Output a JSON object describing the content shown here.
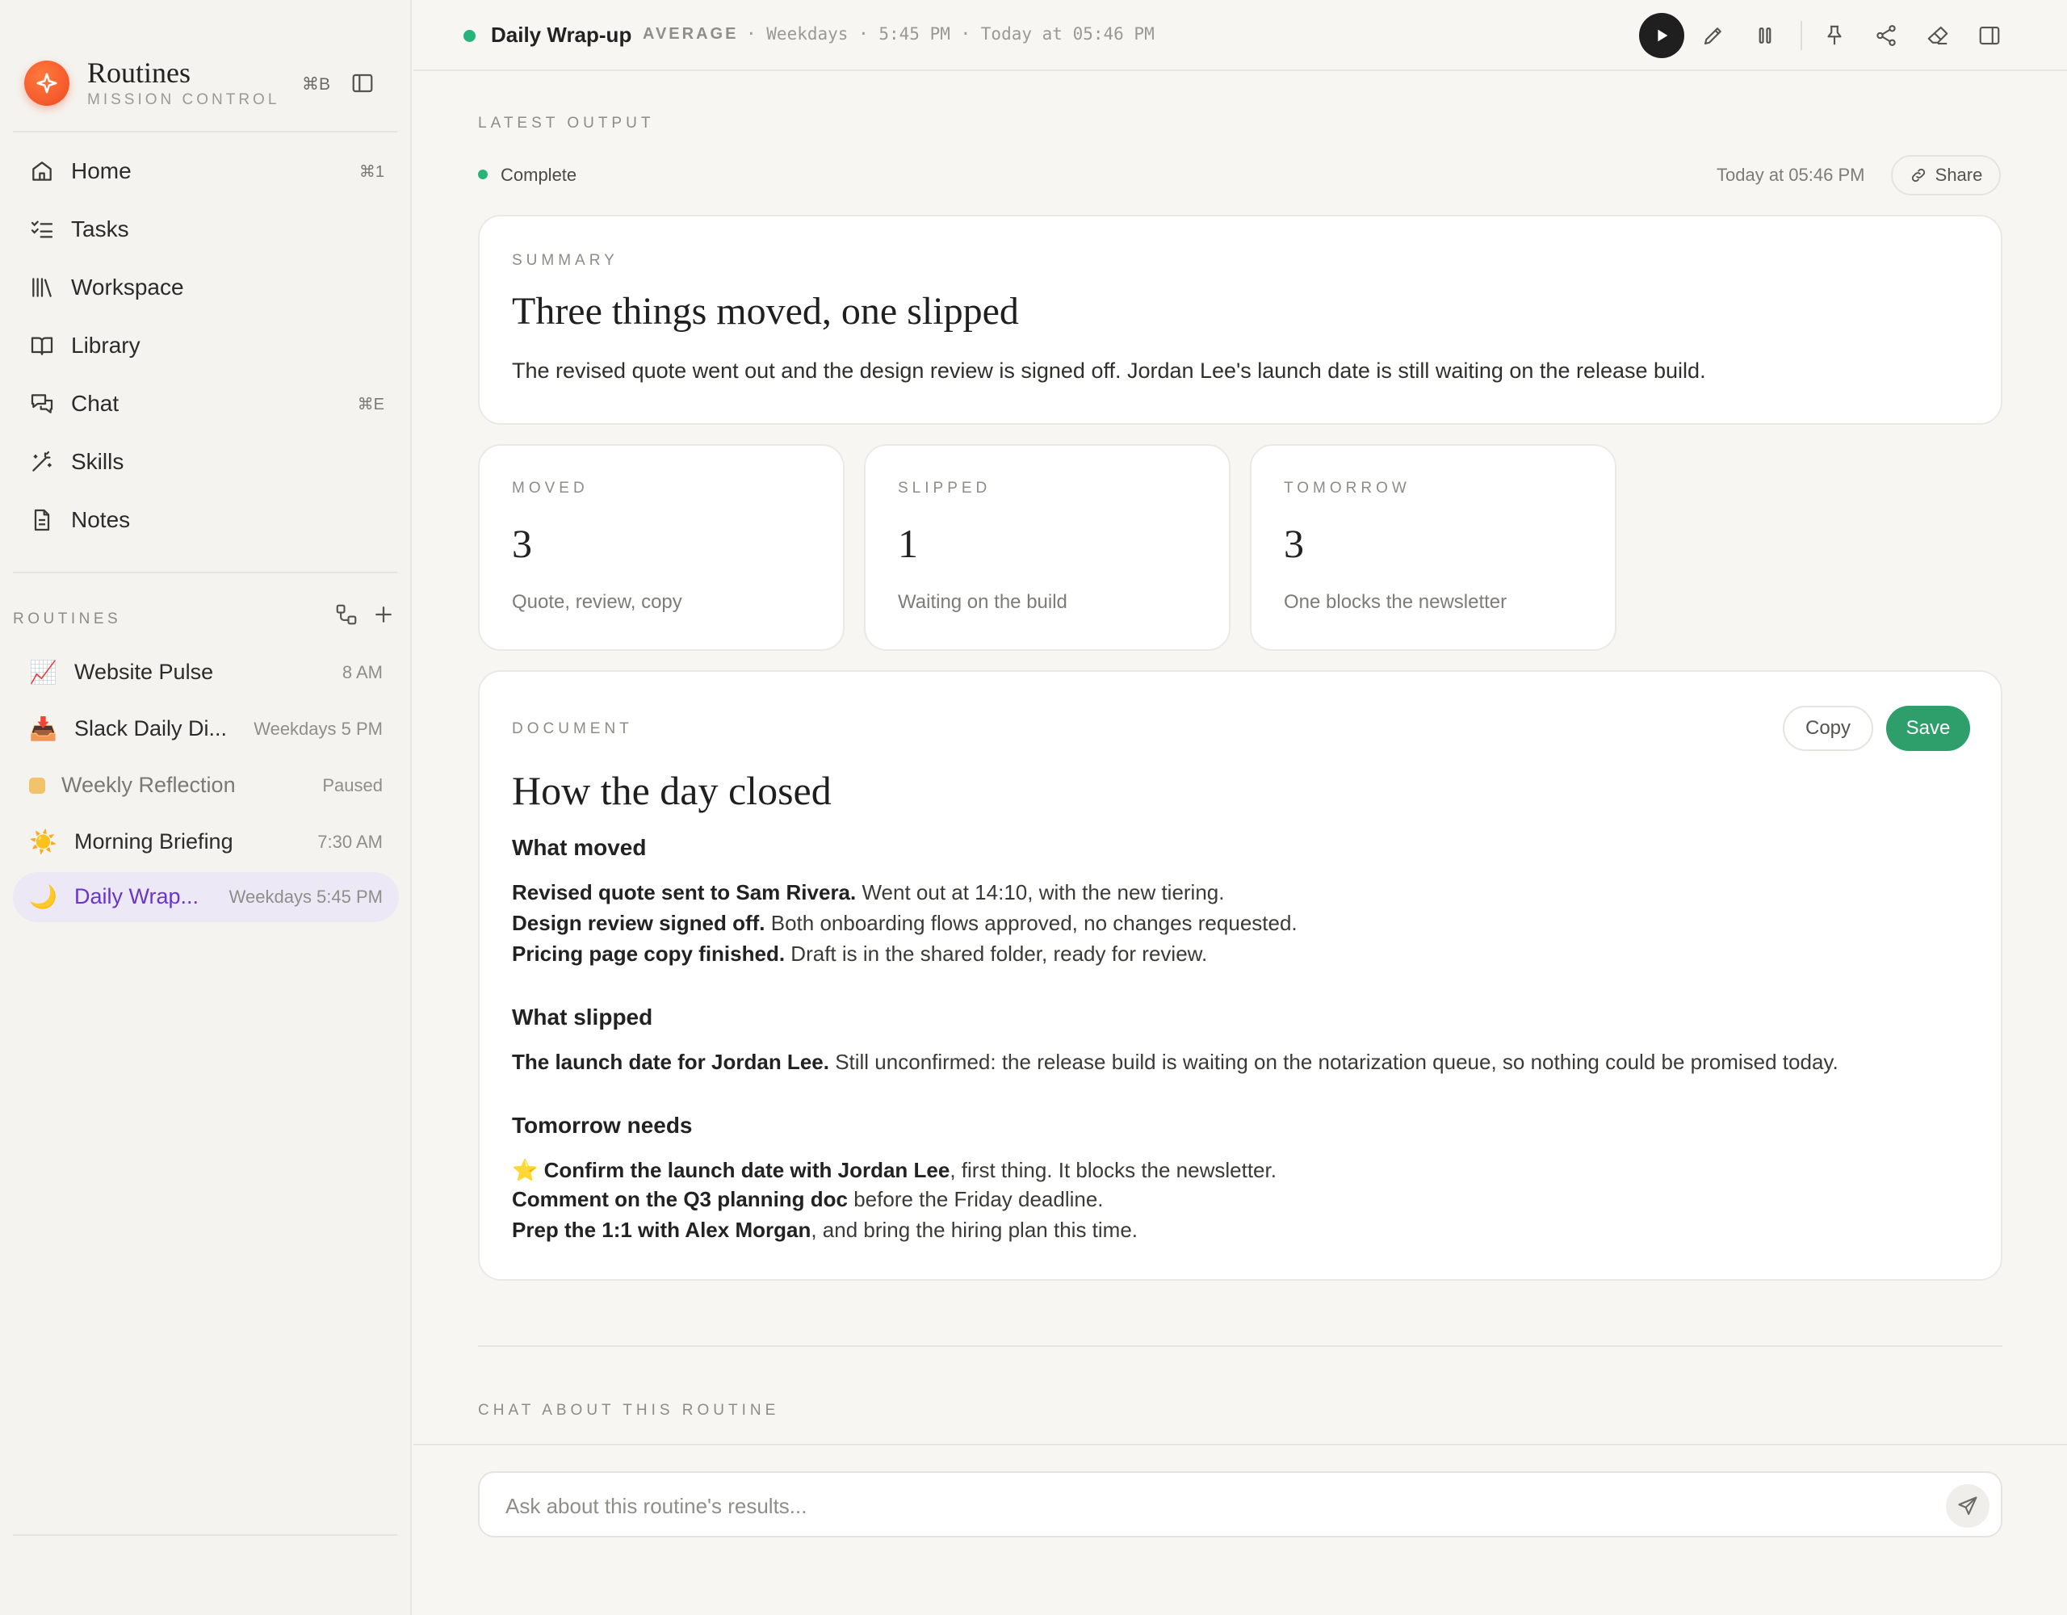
{
  "sidebar": {
    "brand": {
      "title": "Routines",
      "subtitle": "MISSION CONTROL",
      "shortcut": "⌘B"
    },
    "nav": [
      {
        "label": "Home",
        "shortcut": "⌘1",
        "icon": "home-icon"
      },
      {
        "label": "Tasks",
        "shortcut": "",
        "icon": "checklist-icon"
      },
      {
        "label": "Workspace",
        "shortcut": "",
        "icon": "library-icon"
      },
      {
        "label": "Library",
        "shortcut": "",
        "icon": "book-icon"
      },
      {
        "label": "Chat",
        "shortcut": "⌘E",
        "icon": "chat-icon"
      },
      {
        "label": "Skills",
        "shortcut": "",
        "icon": "magic-wand-icon"
      },
      {
        "label": "Notes",
        "shortcut": "",
        "icon": "document-icon"
      }
    ],
    "routines_label": "ROUTINES",
    "routines": [
      {
        "emoji": "📈",
        "name": "Website Pulse",
        "schedule": "8 AM",
        "state": "normal"
      },
      {
        "emoji": "📥",
        "name": "Slack Daily Di...",
        "schedule": "Weekdays 5 PM",
        "state": "normal"
      },
      {
        "emoji": "",
        "name": "Weekly Reflection",
        "schedule": "Paused",
        "state": "paused"
      },
      {
        "emoji": "☀️",
        "name": "Morning Briefing",
        "schedule": "7:30 AM",
        "state": "normal"
      },
      {
        "emoji": "🌙",
        "name": "Daily Wrap...",
        "schedule": "Weekdays 5:45 PM",
        "state": "active"
      }
    ]
  },
  "header": {
    "title": "Daily Wrap-up",
    "level": "AVERAGE",
    "meta": "· Weekdays · 5:45 PM · Today at 05:46 PM"
  },
  "latest_output": {
    "label": "LATEST OUTPUT",
    "status": "Complete",
    "timestamp": "Today at 05:46 PM",
    "share_label": "Share"
  },
  "summary": {
    "label": "SUMMARY",
    "headline": "Three things moved, one slipped",
    "body": "The revised quote went out and the design review is signed off. Jordan Lee's launch date is still waiting on the release build."
  },
  "stats": [
    {
      "label": "MOVED",
      "value": "3",
      "sub": "Quote, review, copy"
    },
    {
      "label": "SLIPPED",
      "value": "1",
      "sub": "Waiting on the build"
    },
    {
      "label": "TOMORROW",
      "value": "3",
      "sub": "One blocks the newsletter"
    }
  ],
  "document": {
    "label": "DOCUMENT",
    "copy_label": "Copy",
    "save_label": "Save",
    "title": "How the day closed",
    "sections": [
      {
        "heading": "What moved",
        "lines": [
          {
            "bold": "Revised quote sent to Sam Rivera.",
            "rest": " Went out at 14:10, with the new tiering."
          },
          {
            "bold": "Design review signed off.",
            "rest": " Both onboarding flows approved, no changes requested."
          },
          {
            "bold": "Pricing page copy finished.",
            "rest": " Draft is in the shared folder, ready for review."
          }
        ]
      },
      {
        "heading": "What slipped",
        "lines": [
          {
            "bold": "The launch date for Jordan Lee.",
            "rest": " Still unconfirmed: the release build is waiting on the notarization queue, so nothing could be promised today."
          }
        ]
      },
      {
        "heading": "Tomorrow needs",
        "lines": [
          {
            "emoji": "⭐",
            "bold": "Confirm the launch date with Jordan Lee",
            "rest": ", first thing. It blocks the newsletter."
          },
          {
            "bold": "Comment on the Q3 planning doc",
            "rest": " before the Friday deadline."
          },
          {
            "bold": "Prep the 1:1 with Alex Morgan",
            "rest": ", and bring the hiring plan this time."
          }
        ]
      }
    ]
  },
  "chat": {
    "label": "CHAT ABOUT THIS ROUTINE",
    "placeholder": "Ask about this routine's results..."
  },
  "colors": {
    "accent_purple": "#6a35c8",
    "status_green": "#27b47a",
    "save_green": "#2e9e6b",
    "brand_orange": "#f04a23"
  }
}
